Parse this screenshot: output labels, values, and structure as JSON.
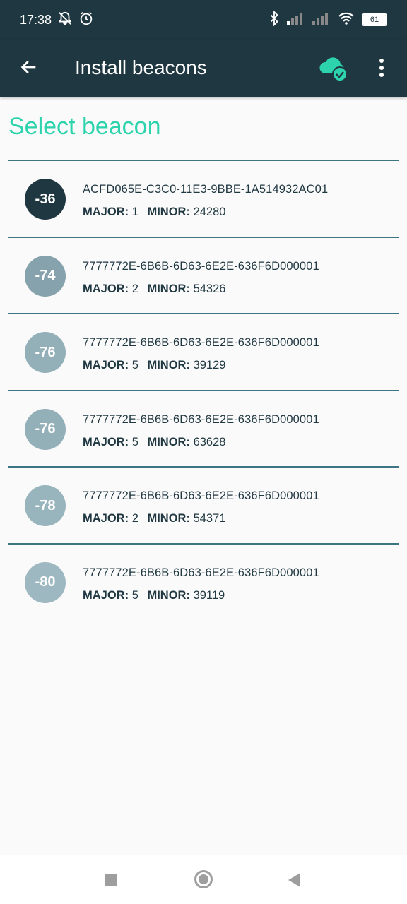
{
  "status_bar": {
    "time": "17:38",
    "battery": "61",
    "icons": [
      "mute-bell-icon",
      "alarm-icon",
      "bluetooth-icon",
      "signal-icon",
      "signal-icon",
      "wifi-icon",
      "battery-icon"
    ]
  },
  "app_bar": {
    "title": "Install beacons",
    "back_icon": "arrow-back-icon",
    "sync_icon": "cloud-check-icon",
    "menu_icon": "more-vert-icon"
  },
  "heading": "Select beacon",
  "labels": {
    "major": "MAJOR:",
    "minor": "MINOR:"
  },
  "beacons": [
    {
      "rssi": "-36",
      "uuid": "ACFD065E-C3C0-11E3-9BBE-1A514932AC01",
      "major": "1",
      "minor": "24280",
      "color": "#1f3741"
    },
    {
      "rssi": "-74",
      "uuid": "7777772E-6B6B-6D63-6E2E-636F6D000001",
      "major": "2",
      "minor": "54326",
      "color": "#86a3ad"
    },
    {
      "rssi": "-76",
      "uuid": "7777772E-6B6B-6D63-6E2E-636F6D000001",
      "major": "5",
      "minor": "39129",
      "color": "#93b0b9"
    },
    {
      "rssi": "-76",
      "uuid": "7777772E-6B6B-6D63-6E2E-636F6D000001",
      "major": "5",
      "minor": "63628",
      "color": "#93b0b9"
    },
    {
      "rssi": "-78",
      "uuid": "7777772E-6B6B-6D63-6E2E-636F6D000001",
      "major": "2",
      "minor": "54371",
      "color": "#98b4bd"
    },
    {
      "rssi": "-80",
      "uuid": "7777772E-6B6B-6D63-6E2E-636F6D000001",
      "major": "5",
      "minor": "39119",
      "color": "#9db8c1"
    }
  ],
  "colors": {
    "primary_dark": "#1f3741",
    "accent": "#2dd3ac",
    "divider": "#3d7585",
    "background": "#fafafa"
  },
  "nav_bar": {
    "icons": [
      "recents-square-icon",
      "home-circle-icon",
      "back-triangle-icon"
    ]
  }
}
